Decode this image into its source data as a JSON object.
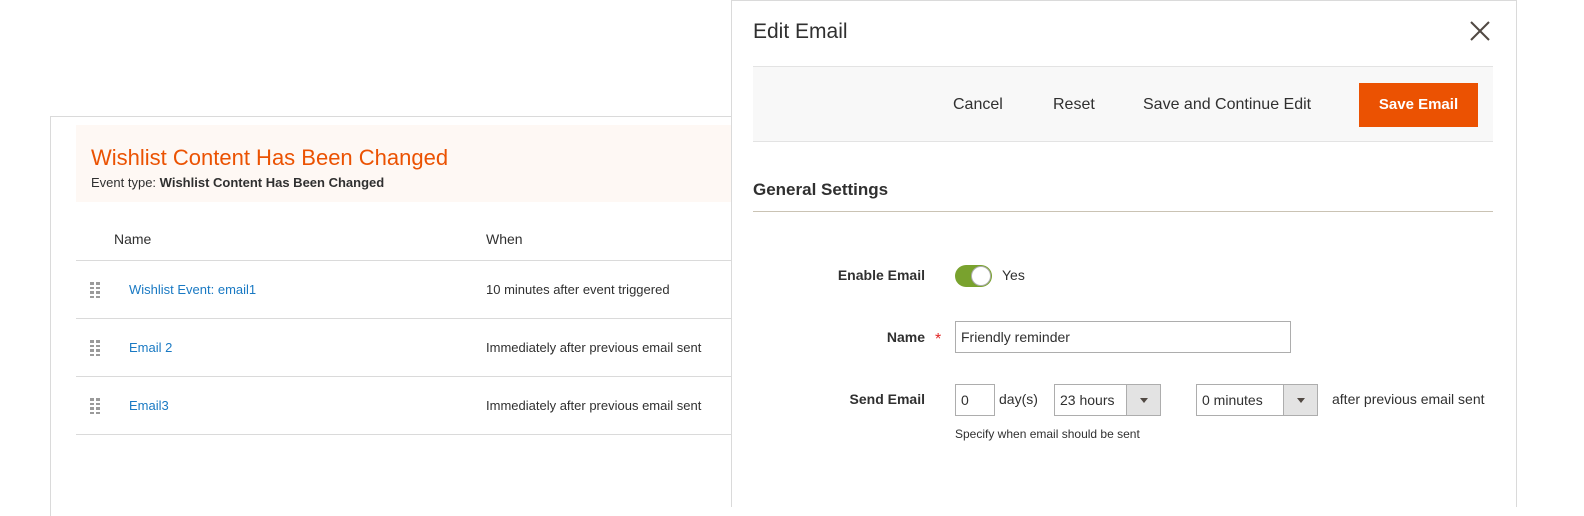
{
  "event": {
    "title": "Wishlist Content Has Been Changed",
    "type_label": "Event type:",
    "type_value": "Wishlist Content Has Been Changed"
  },
  "grid": {
    "columns": {
      "name": "Name",
      "when": "When"
    },
    "rows": [
      {
        "name": "Wishlist Event: email1",
        "when": "10 minutes after event triggered"
      },
      {
        "name": "Email 2",
        "when": "Immediately after previous email sent"
      },
      {
        "name": "Email3",
        "when": "Immediately after previous email sent"
      }
    ]
  },
  "modal": {
    "title": "Edit Email",
    "toolbar": {
      "cancel": "Cancel",
      "reset": "Reset",
      "save_continue": "Save and Continue Edit",
      "save": "Save Email"
    },
    "section_title": "General Settings",
    "fields": {
      "enable_label": "Enable Email",
      "enable_value": "Yes",
      "enable_on": true,
      "name_label": "Name",
      "name_value": "Friendly reminder",
      "send_label": "Send Email",
      "days_value": "0",
      "days_unit": "day(s)",
      "hours_value": "23 hours",
      "minutes_value": "0 minutes",
      "after_text": "after previous email sent",
      "hint": "Specify when email should be sent"
    }
  },
  "colors": {
    "accent": "#eb5202",
    "link": "#1979c3",
    "toggle_on": "#79a22e",
    "header_bg": "#fef8f4"
  },
  "icons": {
    "close": "close-icon",
    "drag": "drag-handle-icon",
    "dropdown": "chevron-down-icon"
  }
}
